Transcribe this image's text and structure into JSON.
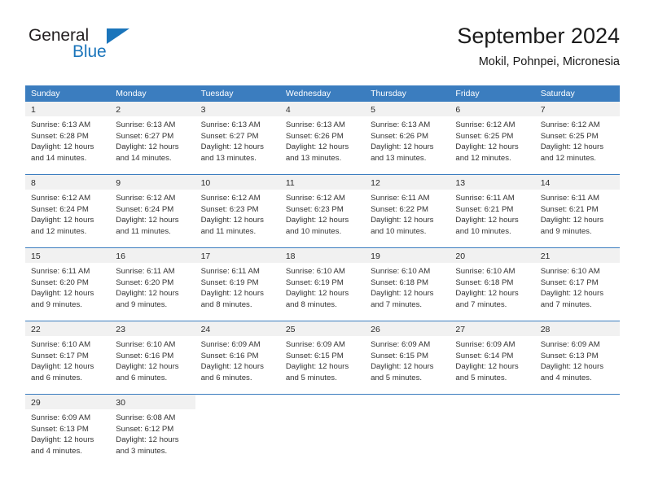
{
  "brand": {
    "name_top": "General",
    "name_bottom": "Blue",
    "accent_color": "#1b75bb"
  },
  "header": {
    "title": "September 2024",
    "subtitle": "Mokil, Pohnpei, Micronesia"
  },
  "theme": {
    "header_row_bg": "#3b7dbf",
    "daynum_band_bg": "#f1f1f1",
    "row_divider": "#3b7dbf",
    "text": "#333333"
  },
  "weekdays": [
    "Sunday",
    "Monday",
    "Tuesday",
    "Wednesday",
    "Thursday",
    "Friday",
    "Saturday"
  ],
  "weeks": [
    [
      {
        "day": "1",
        "sunrise": "Sunrise: 6:13 AM",
        "sunset": "Sunset: 6:28 PM",
        "daylight1": "Daylight: 12 hours",
        "daylight2": "and 14 minutes."
      },
      {
        "day": "2",
        "sunrise": "Sunrise: 6:13 AM",
        "sunset": "Sunset: 6:27 PM",
        "daylight1": "Daylight: 12 hours",
        "daylight2": "and 14 minutes."
      },
      {
        "day": "3",
        "sunrise": "Sunrise: 6:13 AM",
        "sunset": "Sunset: 6:27 PM",
        "daylight1": "Daylight: 12 hours",
        "daylight2": "and 13 minutes."
      },
      {
        "day": "4",
        "sunrise": "Sunrise: 6:13 AM",
        "sunset": "Sunset: 6:26 PM",
        "daylight1": "Daylight: 12 hours",
        "daylight2": "and 13 minutes."
      },
      {
        "day": "5",
        "sunrise": "Sunrise: 6:13 AM",
        "sunset": "Sunset: 6:26 PM",
        "daylight1": "Daylight: 12 hours",
        "daylight2": "and 13 minutes."
      },
      {
        "day": "6",
        "sunrise": "Sunrise: 6:12 AM",
        "sunset": "Sunset: 6:25 PM",
        "daylight1": "Daylight: 12 hours",
        "daylight2": "and 12 minutes."
      },
      {
        "day": "7",
        "sunrise": "Sunrise: 6:12 AM",
        "sunset": "Sunset: 6:25 PM",
        "daylight1": "Daylight: 12 hours",
        "daylight2": "and 12 minutes."
      }
    ],
    [
      {
        "day": "8",
        "sunrise": "Sunrise: 6:12 AM",
        "sunset": "Sunset: 6:24 PM",
        "daylight1": "Daylight: 12 hours",
        "daylight2": "and 12 minutes."
      },
      {
        "day": "9",
        "sunrise": "Sunrise: 6:12 AM",
        "sunset": "Sunset: 6:24 PM",
        "daylight1": "Daylight: 12 hours",
        "daylight2": "and 11 minutes."
      },
      {
        "day": "10",
        "sunrise": "Sunrise: 6:12 AM",
        "sunset": "Sunset: 6:23 PM",
        "daylight1": "Daylight: 12 hours",
        "daylight2": "and 11 minutes."
      },
      {
        "day": "11",
        "sunrise": "Sunrise: 6:12 AM",
        "sunset": "Sunset: 6:23 PM",
        "daylight1": "Daylight: 12 hours",
        "daylight2": "and 10 minutes."
      },
      {
        "day": "12",
        "sunrise": "Sunrise: 6:11 AM",
        "sunset": "Sunset: 6:22 PM",
        "daylight1": "Daylight: 12 hours",
        "daylight2": "and 10 minutes."
      },
      {
        "day": "13",
        "sunrise": "Sunrise: 6:11 AM",
        "sunset": "Sunset: 6:21 PM",
        "daylight1": "Daylight: 12 hours",
        "daylight2": "and 10 minutes."
      },
      {
        "day": "14",
        "sunrise": "Sunrise: 6:11 AM",
        "sunset": "Sunset: 6:21 PM",
        "daylight1": "Daylight: 12 hours",
        "daylight2": "and 9 minutes."
      }
    ],
    [
      {
        "day": "15",
        "sunrise": "Sunrise: 6:11 AM",
        "sunset": "Sunset: 6:20 PM",
        "daylight1": "Daylight: 12 hours",
        "daylight2": "and 9 minutes."
      },
      {
        "day": "16",
        "sunrise": "Sunrise: 6:11 AM",
        "sunset": "Sunset: 6:20 PM",
        "daylight1": "Daylight: 12 hours",
        "daylight2": "and 9 minutes."
      },
      {
        "day": "17",
        "sunrise": "Sunrise: 6:11 AM",
        "sunset": "Sunset: 6:19 PM",
        "daylight1": "Daylight: 12 hours",
        "daylight2": "and 8 minutes."
      },
      {
        "day": "18",
        "sunrise": "Sunrise: 6:10 AM",
        "sunset": "Sunset: 6:19 PM",
        "daylight1": "Daylight: 12 hours",
        "daylight2": "and 8 minutes."
      },
      {
        "day": "19",
        "sunrise": "Sunrise: 6:10 AM",
        "sunset": "Sunset: 6:18 PM",
        "daylight1": "Daylight: 12 hours",
        "daylight2": "and 7 minutes."
      },
      {
        "day": "20",
        "sunrise": "Sunrise: 6:10 AM",
        "sunset": "Sunset: 6:18 PM",
        "daylight1": "Daylight: 12 hours",
        "daylight2": "and 7 minutes."
      },
      {
        "day": "21",
        "sunrise": "Sunrise: 6:10 AM",
        "sunset": "Sunset: 6:17 PM",
        "daylight1": "Daylight: 12 hours",
        "daylight2": "and 7 minutes."
      }
    ],
    [
      {
        "day": "22",
        "sunrise": "Sunrise: 6:10 AM",
        "sunset": "Sunset: 6:17 PM",
        "daylight1": "Daylight: 12 hours",
        "daylight2": "and 6 minutes."
      },
      {
        "day": "23",
        "sunrise": "Sunrise: 6:10 AM",
        "sunset": "Sunset: 6:16 PM",
        "daylight1": "Daylight: 12 hours",
        "daylight2": "and 6 minutes."
      },
      {
        "day": "24",
        "sunrise": "Sunrise: 6:09 AM",
        "sunset": "Sunset: 6:16 PM",
        "daylight1": "Daylight: 12 hours",
        "daylight2": "and 6 minutes."
      },
      {
        "day": "25",
        "sunrise": "Sunrise: 6:09 AM",
        "sunset": "Sunset: 6:15 PM",
        "daylight1": "Daylight: 12 hours",
        "daylight2": "and 5 minutes."
      },
      {
        "day": "26",
        "sunrise": "Sunrise: 6:09 AM",
        "sunset": "Sunset: 6:15 PM",
        "daylight1": "Daylight: 12 hours",
        "daylight2": "and 5 minutes."
      },
      {
        "day": "27",
        "sunrise": "Sunrise: 6:09 AM",
        "sunset": "Sunset: 6:14 PM",
        "daylight1": "Daylight: 12 hours",
        "daylight2": "and 5 minutes."
      },
      {
        "day": "28",
        "sunrise": "Sunrise: 6:09 AM",
        "sunset": "Sunset: 6:13 PM",
        "daylight1": "Daylight: 12 hours",
        "daylight2": "and 4 minutes."
      }
    ],
    [
      {
        "day": "29",
        "sunrise": "Sunrise: 6:09 AM",
        "sunset": "Sunset: 6:13 PM",
        "daylight1": "Daylight: 12 hours",
        "daylight2": "and 4 minutes."
      },
      {
        "day": "30",
        "sunrise": "Sunrise: 6:08 AM",
        "sunset": "Sunset: 6:12 PM",
        "daylight1": "Daylight: 12 hours",
        "daylight2": "and 3 minutes."
      },
      {
        "day": "",
        "sunrise": "",
        "sunset": "",
        "daylight1": "",
        "daylight2": ""
      },
      {
        "day": "",
        "sunrise": "",
        "sunset": "",
        "daylight1": "",
        "daylight2": ""
      },
      {
        "day": "",
        "sunrise": "",
        "sunset": "",
        "daylight1": "",
        "daylight2": ""
      },
      {
        "day": "",
        "sunrise": "",
        "sunset": "",
        "daylight1": "",
        "daylight2": ""
      },
      {
        "day": "",
        "sunrise": "",
        "sunset": "",
        "daylight1": "",
        "daylight2": ""
      }
    ]
  ]
}
